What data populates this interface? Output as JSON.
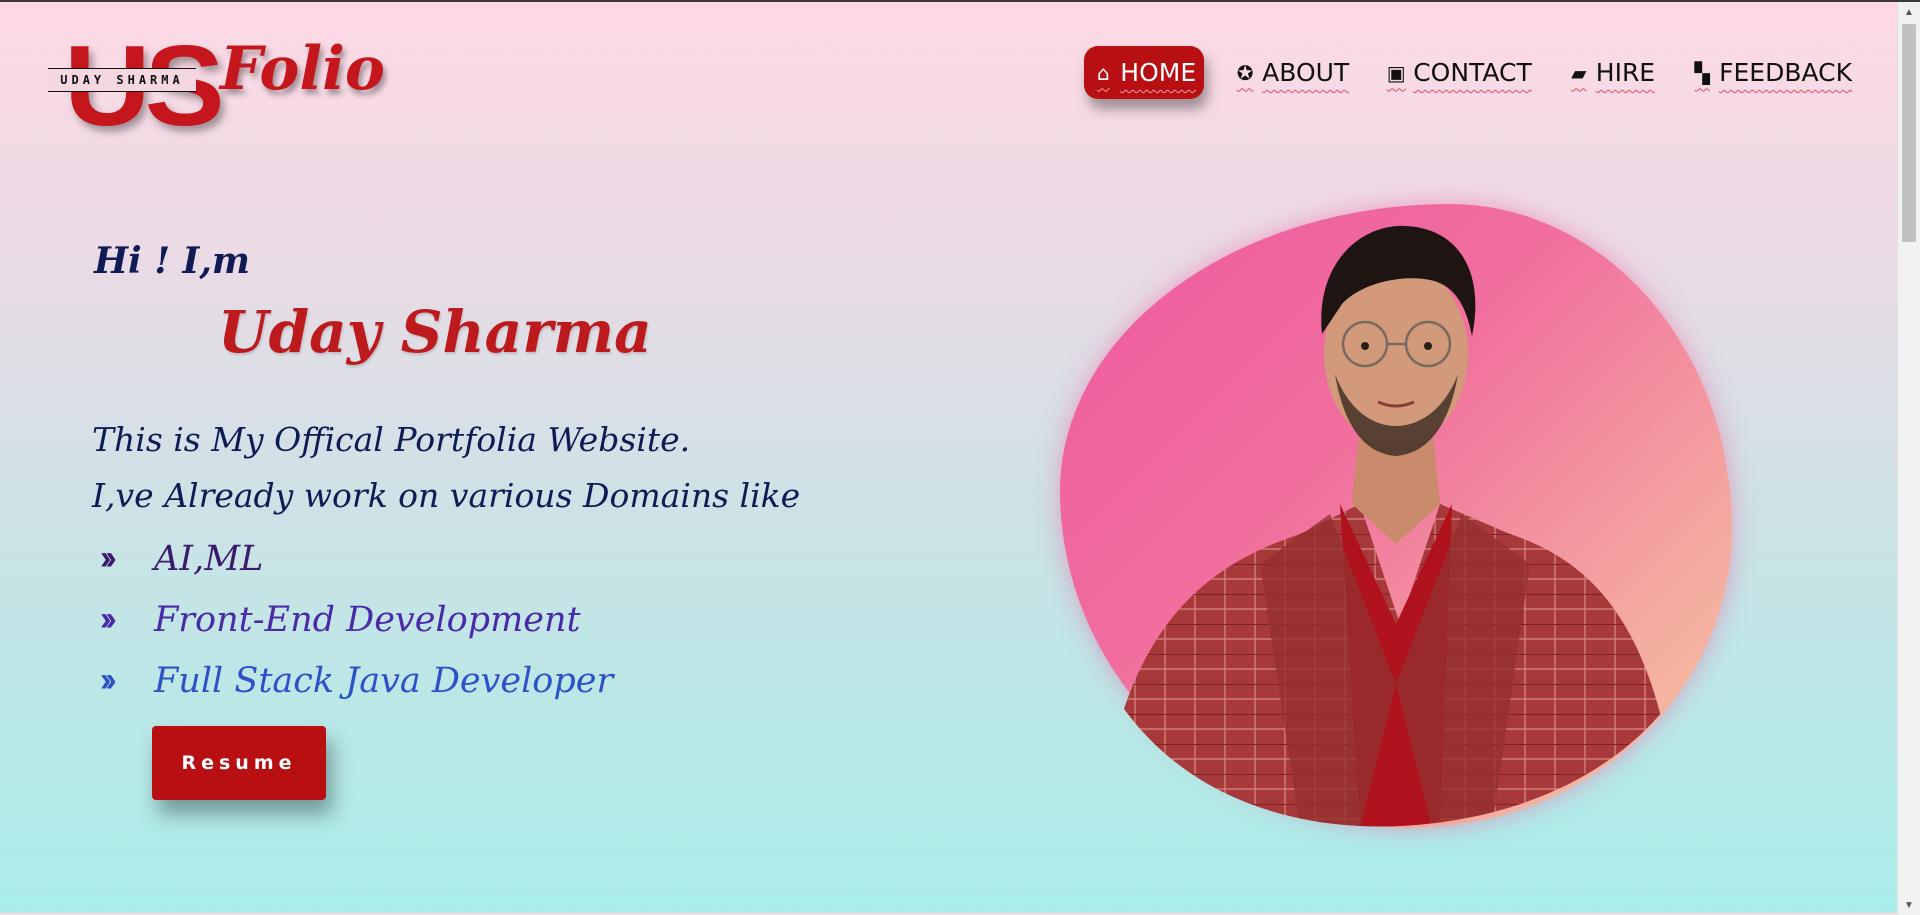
{
  "logo": {
    "monogram": "US",
    "name_band": "UDAY SHARMA",
    "wordmark": "Folio"
  },
  "nav": {
    "items": [
      {
        "label": "HOME",
        "icon": "home-icon",
        "glyph": "⌂"
      },
      {
        "label": "ABOUT",
        "icon": "aperture-icon",
        "glyph": "✪"
      },
      {
        "label": "CONTACT",
        "icon": "contact-card-icon",
        "glyph": "▣"
      },
      {
        "label": "HIRE",
        "icon": "briefcase-icon",
        "glyph": "▰"
      },
      {
        "label": "FEEDBACK",
        "icon": "comments-icon",
        "glyph": "▚"
      }
    ],
    "active": "HOME",
    "active_color": "#b80f12"
  },
  "hero": {
    "greeting": "Hi ! I,m",
    "name": "Uday Sharma",
    "intro_line1": "This is My Offical Portfolia Website.",
    "intro_line2": "I,ve Already work on various Domains like",
    "domains": [
      {
        "text": "AI,ML",
        "color": "#3a1a6a"
      },
      {
        "text": "Front-End Development",
        "color": "#4b2aa8"
      },
      {
        "text": "Full Stack Java Developer",
        "color": "#2d52c8"
      }
    ],
    "bullet_icon": "double-chevron-right-icon",
    "resume_label": "Resume"
  },
  "colors": {
    "accent": "#b80f12",
    "name_red": "#bd1a1e",
    "navy": "#101a55"
  }
}
